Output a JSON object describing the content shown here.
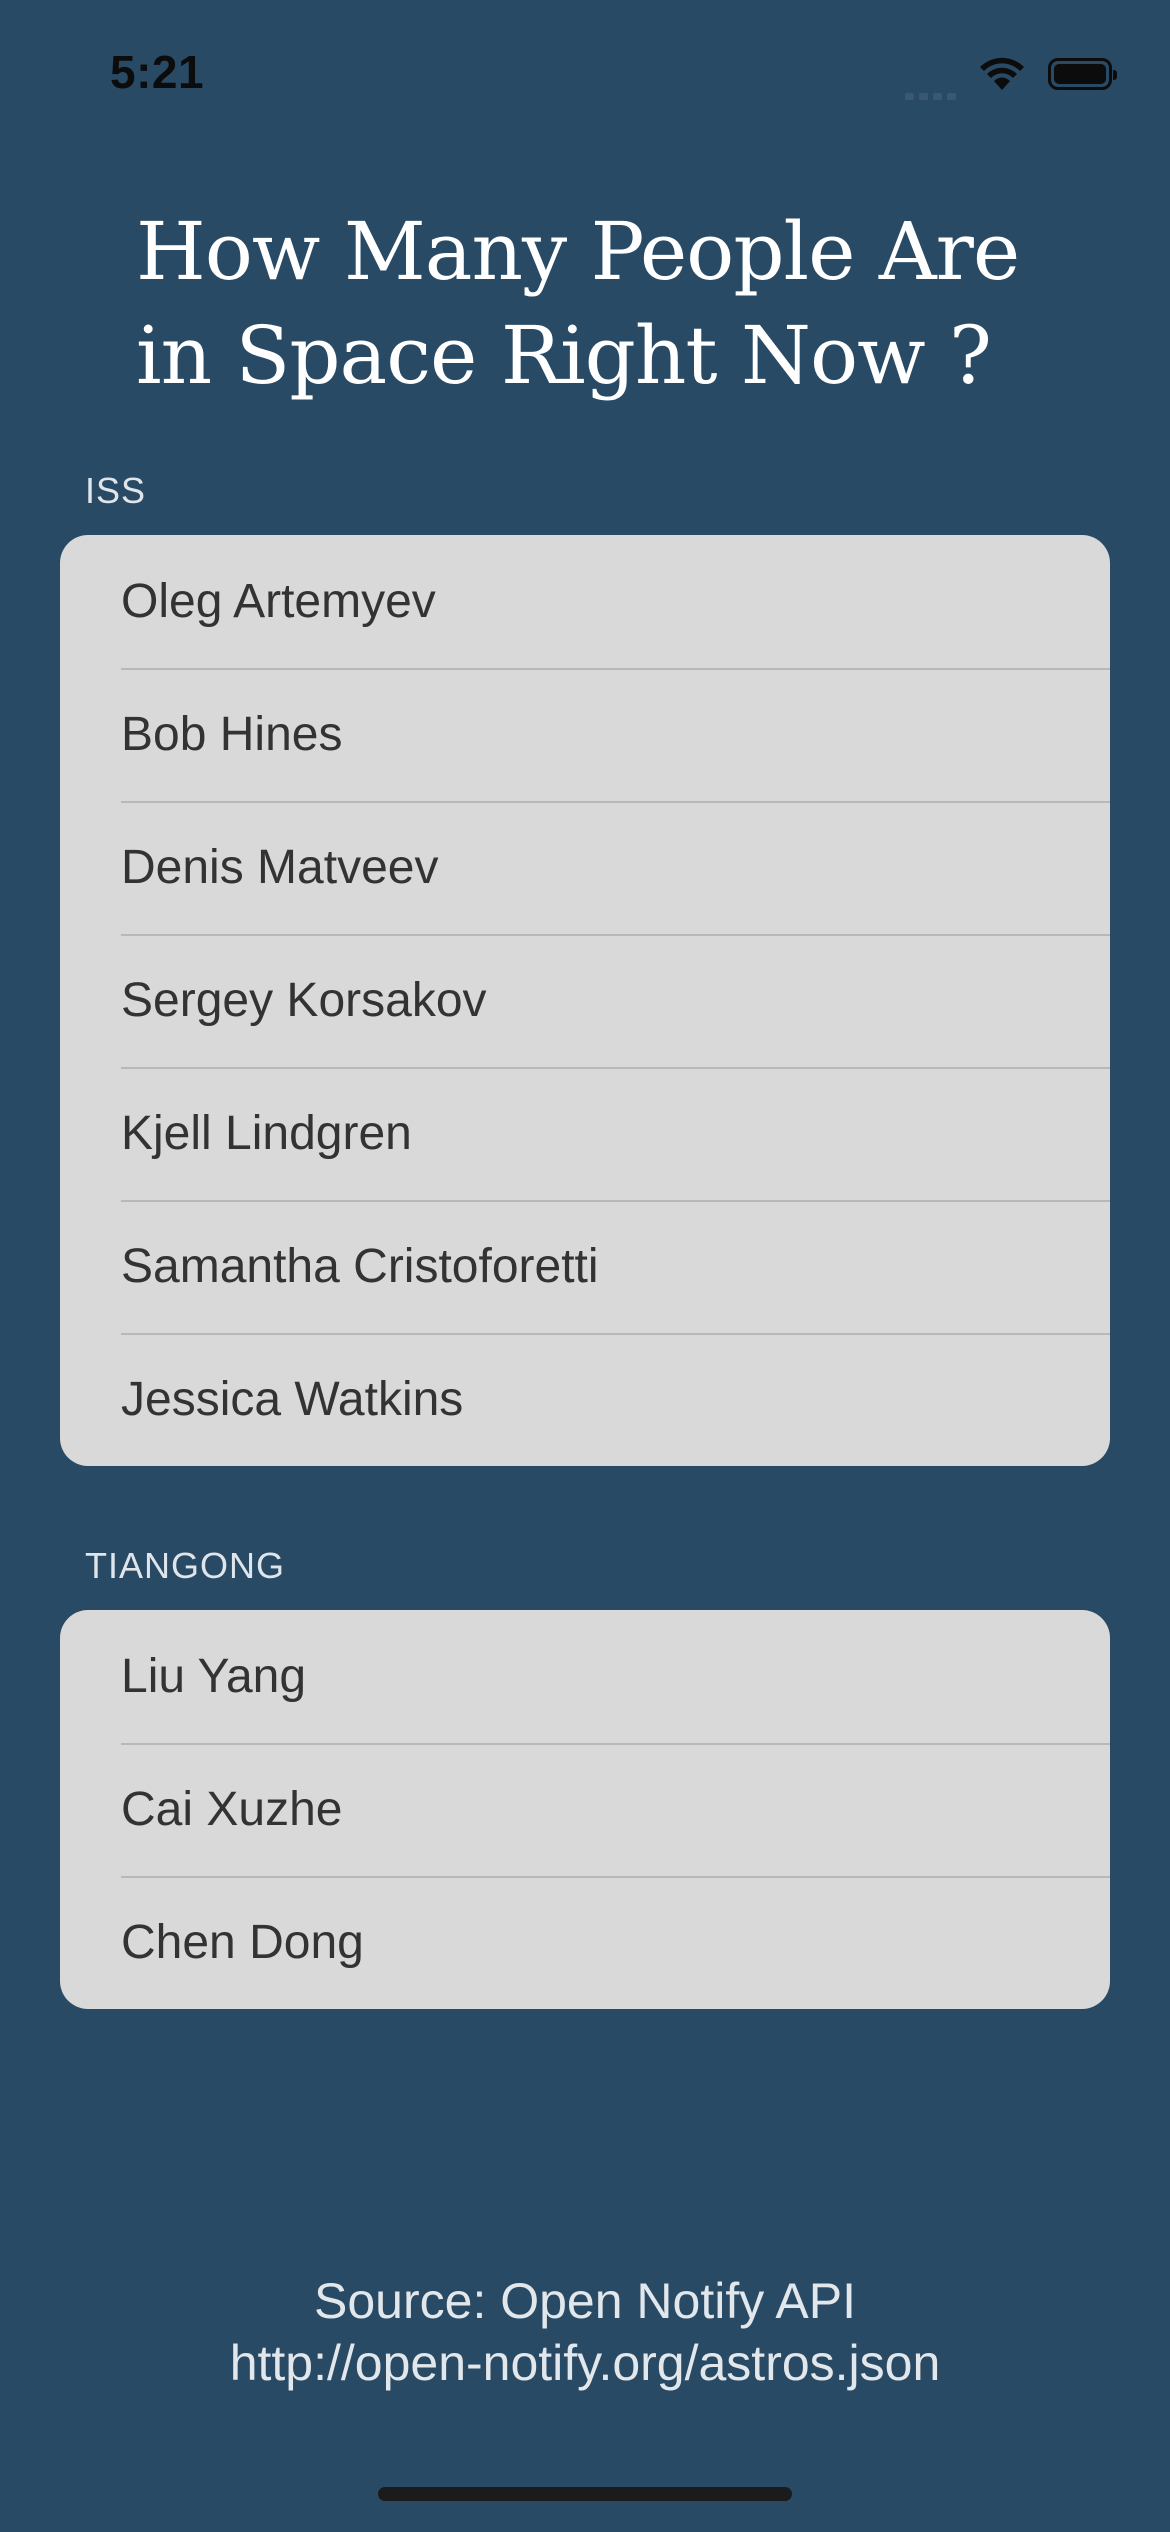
{
  "status_bar": {
    "time": "5:21",
    "icons": [
      "cellular-signal-icon",
      "wifi-icon",
      "battery-icon"
    ]
  },
  "title": "How Many People Are in Space Right Now ?",
  "sections": [
    {
      "header": "ISS",
      "people": [
        "Oleg Artemyev",
        "Bob Hines",
        "Denis Matveev",
        "Sergey Korsakov",
        "Kjell Lindgren",
        "Samantha Cristoforetti",
        "Jessica Watkins"
      ]
    },
    {
      "header": "TIANGONG",
      "people": [
        "Liu Yang",
        "Cai Xuzhe",
        "Chen Dong"
      ]
    }
  ],
  "footer": {
    "source": "Source: Open Notify API",
    "url": "http://open-notify.org/astros.json"
  },
  "colors": {
    "background": "#294a65",
    "card": "#d9d9d9",
    "row_text": "#333333",
    "title_text": "#ffffff"
  }
}
